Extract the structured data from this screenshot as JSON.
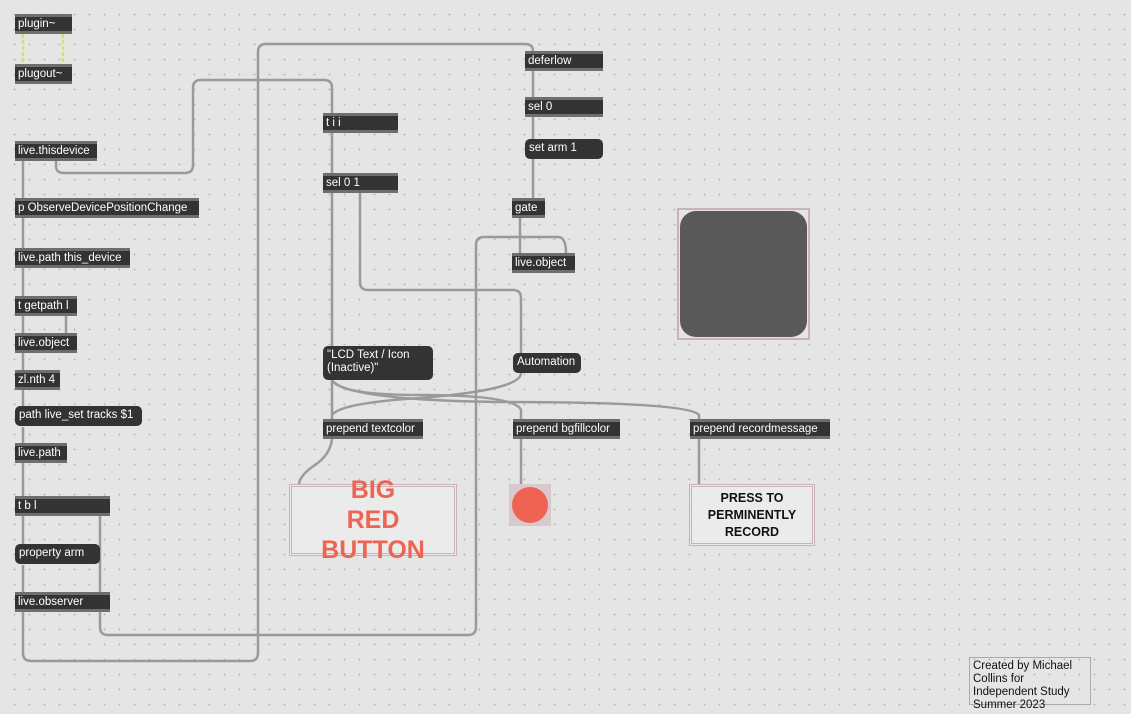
{
  "objects": {
    "plugin": "plugin~",
    "plugout": "plugout~",
    "thisdevice": "live.thisdevice",
    "observe": "p ObserveDevicePositionChange",
    "path_this": "live.path this_device",
    "getpath": "t getpath l",
    "liveobject1": "live.object",
    "zlnth": "zl.nth 4",
    "path_tracks": "path live_set tracks $1",
    "livepath": "live.path",
    "tbl": "t b l",
    "property": "property arm",
    "observer": "live.observer",
    "tii": "t i i",
    "sel01": "sel 0 1",
    "deferlow": "deferlow",
    "sel0": "sel 0",
    "setarm": "set arm 1",
    "gate": "gate",
    "liveobject2": "live.object",
    "lcd": "\"LCD Text / Icon (Inactive)\"",
    "automation": "Automation",
    "textcolor": "prepend textcolor",
    "bgfillcolor": "prepend bgfillcolor",
    "recordmessage": "prepend recordmessage"
  },
  "ui": {
    "big_red_button": "BIG RED BUTTON",
    "record_button": "PRESS TO PERMINENTLY RECORD"
  },
  "credit": "Created by Michael Collins for Independent Study Summer 2023",
  "colors": {
    "accent_red": "#ee6352",
    "panel": "#595959",
    "background": "#e5e5e5"
  }
}
